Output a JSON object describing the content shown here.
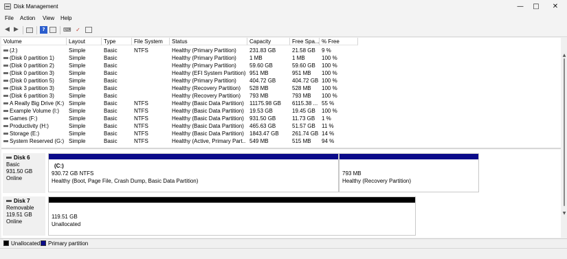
{
  "window": {
    "title": "Disk Management"
  },
  "menu": [
    "File",
    "Action",
    "View",
    "Help"
  ],
  "volume_table": {
    "headers": [
      "Volume",
      "Layout",
      "Type",
      "File System",
      "Status",
      "Capacity",
      "Free Spa...",
      "% Free"
    ],
    "rows": [
      [
        "(J:)",
        "Simple",
        "Basic",
        "NTFS",
        "Healthy (Primary Partition)",
        "231.83 GB",
        "21.58 GB",
        "9 %"
      ],
      [
        "(Disk 0 partition 1)",
        "Simple",
        "Basic",
        "",
        "Healthy (Primary Partition)",
        "1 MB",
        "1 MB",
        "100 %"
      ],
      [
        "(Disk 0 partition 2)",
        "Simple",
        "Basic",
        "",
        "Healthy (Primary Partition)",
        "59.60 GB",
        "59.60 GB",
        "100 %"
      ],
      [
        "(Disk 0 partition 3)",
        "Simple",
        "Basic",
        "",
        "Healthy (EFI System Partition)",
        "951 MB",
        "951 MB",
        "100 %"
      ],
      [
        "(Disk 0 partition 5)",
        "Simple",
        "Basic",
        "",
        "Healthy (Primary Partition)",
        "404.72 GB",
        "404.72 GB",
        "100 %"
      ],
      [
        "(Disk 3 partition 3)",
        "Simple",
        "Basic",
        "",
        "Healthy (Recovery Partition)",
        "528 MB",
        "528 MB",
        "100 %"
      ],
      [
        "(Disk 6 partition 3)",
        "Simple",
        "Basic",
        "",
        "Healthy (Recovery Partition)",
        "793 MB",
        "793 MB",
        "100 %"
      ],
      [
        "A Really Big Drive (K:)",
        "Simple",
        "Basic",
        "NTFS",
        "Healthy (Basic Data Partition)",
        "11175.98 GB",
        "6115.38 ...",
        "55 %"
      ],
      [
        "Example Volume (I:)",
        "Simple",
        "Basic",
        "NTFS",
        "Healthy (Basic Data Partition)",
        "19.53 GB",
        "19.45 GB",
        "100 %"
      ],
      [
        "Games (F:)",
        "Simple",
        "Basic",
        "NTFS",
        "Healthy (Basic Data Partition)",
        "931.50 GB",
        "11.73 GB",
        "1 %"
      ],
      [
        "Productivity (H:)",
        "Simple",
        "Basic",
        "NTFS",
        "Healthy (Basic Data Partition)",
        "465.63 GB",
        "51.57 GB",
        "11 %"
      ],
      [
        "Storage (E:)",
        "Simple",
        "Basic",
        "NTFS",
        "Healthy (Basic Data Partition)",
        "1843.47 GB",
        "261.74 GB",
        "14 %"
      ],
      [
        "System Reserved (G:)",
        "Simple",
        "Basic",
        "NTFS",
        "Healthy (Active, Primary Part...",
        "549 MB",
        "515 MB",
        "94 %"
      ]
    ]
  },
  "disks": [
    {
      "name": "Disk 6",
      "type": "Basic",
      "size": "931.50 GB",
      "state": "Online",
      "partitions": [
        {
          "title": "(C:)",
          "line1": "930.72 GB NTFS",
          "line2": "Healthy (Boot, Page File, Crash Dump, Basic Data Partition)",
          "kind": "primary"
        },
        {
          "title": "",
          "line1": "793 MB",
          "line2": "Healthy (Recovery Partition)",
          "kind": "primary"
        }
      ]
    },
    {
      "name": "Disk 7",
      "type": "Removable",
      "size": "119.51 GB",
      "state": "Online",
      "partitions": [
        {
          "title": "",
          "line1": "119.51 GB",
          "line2": "Unallocated",
          "kind": "unallocated"
        }
      ]
    }
  ],
  "legend": [
    {
      "label": "Unallocated",
      "color": "#000000"
    },
    {
      "label": "Primary partition",
      "color": "#0b0b8a"
    }
  ],
  "colors": {
    "primary": "#0b0b8a",
    "unallocated": "#000000"
  }
}
